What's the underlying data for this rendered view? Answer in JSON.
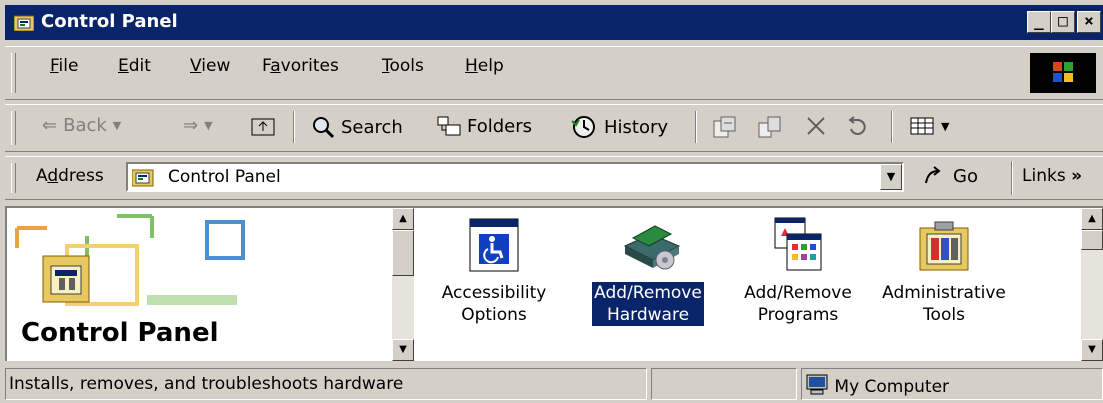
{
  "window": {
    "title": "Control Panel",
    "min_label": "_",
    "max_label": "□",
    "close_label": "×"
  },
  "menu": {
    "items": [
      {
        "pre": "",
        "u": "F",
        "post": "ile"
      },
      {
        "pre": "",
        "u": "E",
        "post": "dit"
      },
      {
        "pre": "",
        "u": "V",
        "post": "iew"
      },
      {
        "pre": "F",
        "u": "a",
        "post": "vorites"
      },
      {
        "pre": "",
        "u": "T",
        "post": "ools"
      },
      {
        "pre": "",
        "u": "H",
        "post": "elp"
      }
    ]
  },
  "toolbar": {
    "back_label": "Back",
    "search_label": "Search",
    "folders_label": "Folders",
    "history_label": "History"
  },
  "address": {
    "label_pre": "A",
    "label_u": "d",
    "label_post": "dress",
    "value": "Control Panel",
    "go_label": "Go",
    "links_label": "Links",
    "links_chevron": "»"
  },
  "content": {
    "banner_title": "Control Panel",
    "items": [
      {
        "line1": "Accessibility",
        "line2": "Options",
        "icon": "accessibility-icon",
        "selected": false
      },
      {
        "line1": "Add/Remove",
        "line2": "Hardware",
        "icon": "hardware-icon",
        "selected": true
      },
      {
        "line1": "Add/Remove",
        "line2": "Programs",
        "icon": "programs-icon",
        "selected": false
      },
      {
        "line1": "Administrative",
        "line2": "Tools",
        "icon": "admin-tools-icon",
        "selected": false
      }
    ]
  },
  "status": {
    "text": "Installs, removes, and troubleshoots hardware",
    "zone": "My Computer"
  },
  "colors": {
    "titlebar": "#0a246a",
    "selection": "#0a246a",
    "face": "#d4d0c8"
  }
}
